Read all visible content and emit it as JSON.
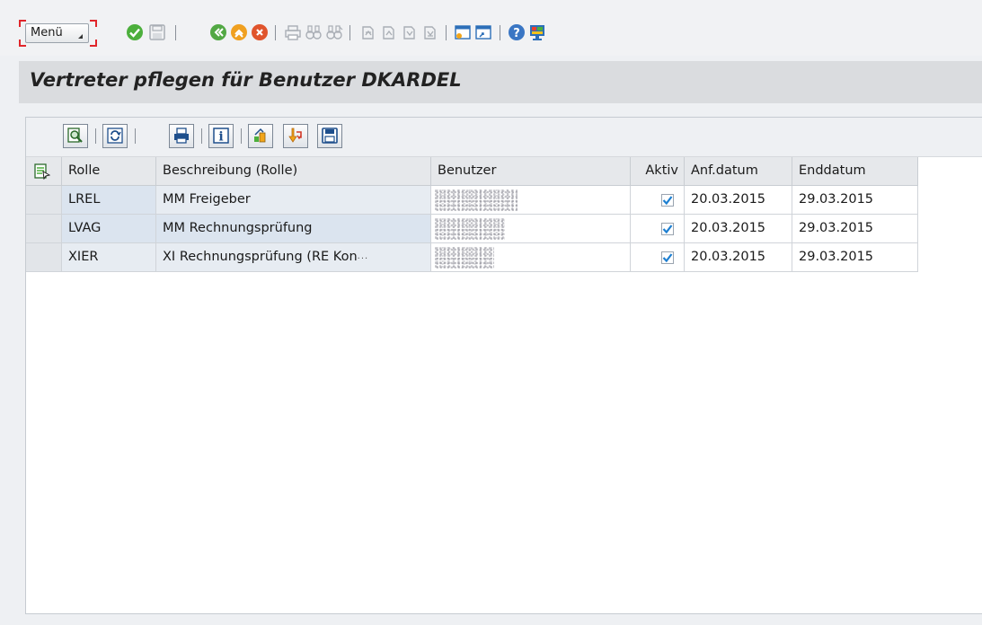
{
  "toolbar": {
    "menu_label": "Menü",
    "icons": [
      "enter-check-icon",
      "save-icon",
      "back-icon",
      "exit-icon",
      "cancel-icon",
      "print-icon",
      "find-icon",
      "find-next-icon",
      "first-page-icon",
      "previous-page-icon",
      "next-page-icon",
      "last-page-icon",
      "create-session-icon",
      "generate-shortcut-icon",
      "help-icon",
      "customize-layout-icon"
    ]
  },
  "page": {
    "title": "Vertreter pflegen für Benutzer DKARDEL"
  },
  "alv_toolbar": {
    "icons": [
      "details-icon",
      "refresh-icon",
      "print-icon",
      "info-icon",
      "select-layout-icon",
      "export-icon",
      "save-layout-icon"
    ]
  },
  "table": {
    "columns": [
      "Rolle",
      "Beschreibung (Rolle)",
      "Benutzer",
      "Aktiv",
      "Anf.datum",
      "Enddatum"
    ],
    "rows": [
      {
        "rolle": "LREL",
        "beschreibung": "MM Freigeber",
        "benutzer": "",
        "aktiv": true,
        "anf_datum": "20.03.2015",
        "enddatum": "29.03.2015"
      },
      {
        "rolle": "LVAG",
        "beschreibung": "MM Rechnungsprüfung",
        "benutzer": "",
        "aktiv": true,
        "anf_datum": "20.03.2015",
        "enddatum": "29.03.2015"
      },
      {
        "rolle": "XIER",
        "beschreibung": "XI Rechnungsprüfung (RE Kon",
        "benutzer": "",
        "aktiv": true,
        "anf_datum": "20.03.2015",
        "enddatum": "29.03.2015"
      }
    ]
  },
  "colors": {
    "accent_red": "#e0262b",
    "check_blue": "#1d7fd1",
    "key_cell": "#dbe4ef"
  }
}
